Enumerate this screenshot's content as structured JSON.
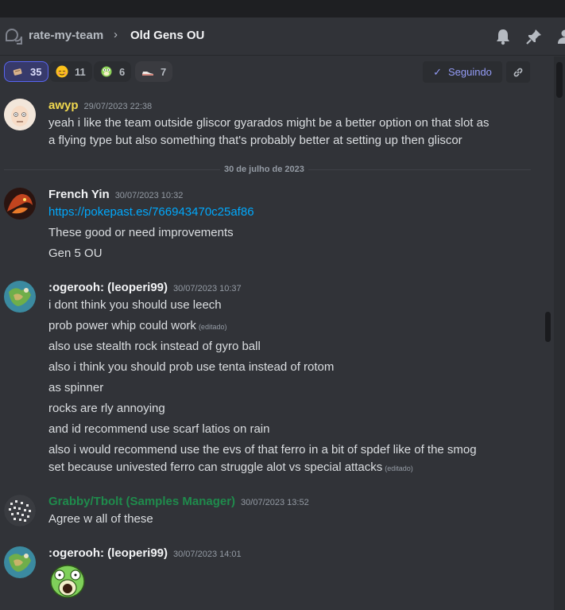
{
  "header": {
    "channel": "rate-my-team",
    "thread": "Old Gens OU",
    "icons": [
      "thread-icon",
      "bell-icon",
      "pin-icon",
      "members-icon"
    ]
  },
  "reactions": [
    {
      "emoji": "scroll-emoji",
      "count": "35",
      "selected": true
    },
    {
      "emoji": "relieved-face-emoji",
      "count": "11",
      "selected": false
    },
    {
      "emoji": "psyduck-emoji",
      "count": "6",
      "selected": false
    },
    {
      "emoji": "sneaker-emoji",
      "count": "7",
      "selected": false
    }
  ],
  "follow_label": "Seguindo",
  "date_divider": "30 de julho de 2023",
  "messages": [
    {
      "author": "awyp",
      "author_color": "#f0d84f",
      "time": "29/07/2023 22:38",
      "lines": [
        "yeah i like the team outside gliscor gyarados might be a better option on that slot as",
        "a flying type but also something that's probably better at setting up then gliscor"
      ]
    },
    {
      "author": "French Yin",
      "author_color": "#f2f3f5",
      "time": "30/07/2023 10:32",
      "link": "https://pokepast.es/766943470c25af86",
      "lines": [
        "These good or need improvements",
        "Gen 5 OU"
      ]
    },
    {
      "author": ":ogerooh: (leoperi99)",
      "author_color": "#f2f3f5",
      "time": "30/07/2023 10:37",
      "lines": [
        "i dont think you should use leech",
        "prob power whip could work",
        "also use stealth rock instead of gyro ball",
        "also i think you should prob use tenta instead of rotom",
        "as spinner",
        "rocks are rly annoying",
        "and id recommend use scarf latios on rain",
        "also i would recommend use the evs of that ferro in a bit of spdef like of the smog",
        "set because univested ferro can struggle alot vs special attacks"
      ],
      "edited_label": "(editado)"
    },
    {
      "author": "Grabby/Tbolt (Samples Manager)",
      "author_color": "#1f8b4c",
      "time": "30/07/2023 13:52",
      "lines": [
        "Agree w all of these"
      ]
    },
    {
      "author": ":ogerooh: (leoperi99)",
      "author_color": "#f2f3f5",
      "time": "30/07/2023 14:01",
      "emoji": "psyduck-emoji"
    }
  ]
}
